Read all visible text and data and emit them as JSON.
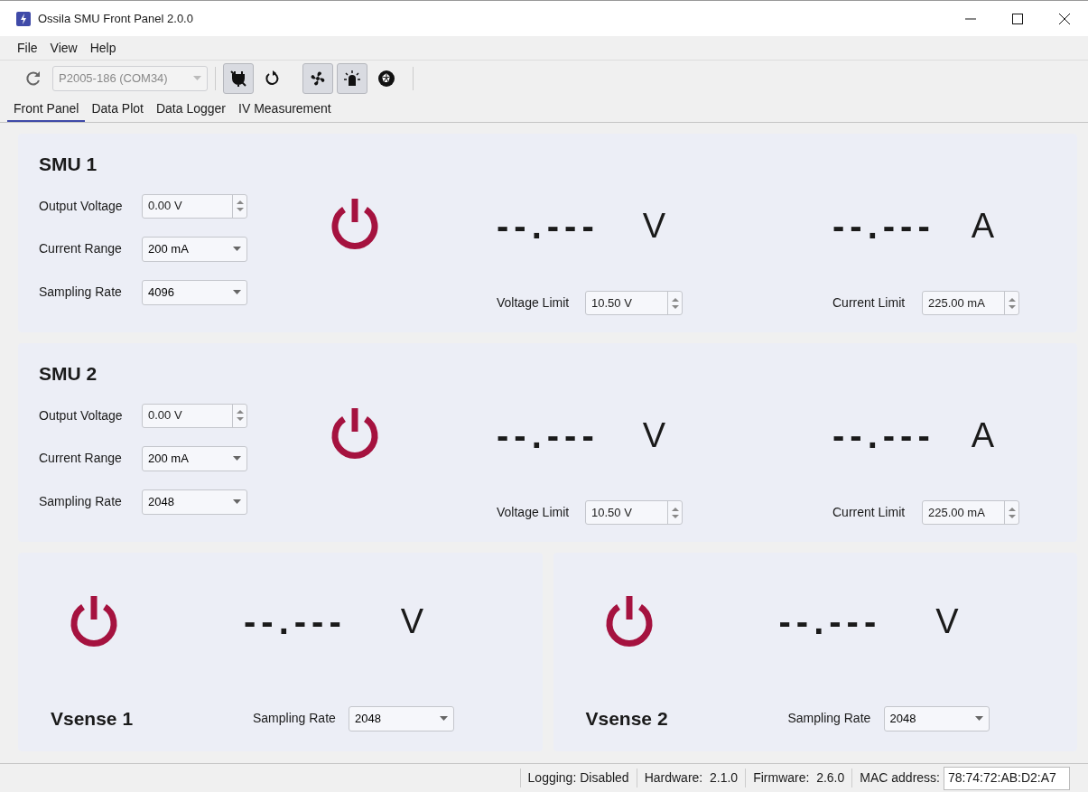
{
  "window": {
    "title": "Ossila SMU Front Panel 2.0.0"
  },
  "menu": [
    "File",
    "View",
    "Help"
  ],
  "toolbar": {
    "device": {
      "value": "P2005-186 (COM34)",
      "disabled": true
    },
    "buttons": [
      {
        "kind": "unplug",
        "pressed": true
      },
      {
        "kind": "reset",
        "pressed": false
      },
      {
        "kind": "fan",
        "pressed": true
      },
      {
        "kind": "light",
        "pressed": true
      },
      {
        "kind": "shutter",
        "pressed": false
      }
    ]
  },
  "tabs": [
    {
      "label": "Front Panel",
      "selected": true
    },
    {
      "label": "Data Plot",
      "selected": false
    },
    {
      "label": "Data Logger",
      "selected": false
    },
    {
      "label": "IV Measurement",
      "selected": false
    }
  ],
  "smus": [
    {
      "title": "SMU 1",
      "output_voltage": {
        "label": "Output Voltage",
        "value": "0.00 V"
      },
      "current_range": {
        "label": "Current Range",
        "value": "200 mA"
      },
      "sampling_rate": {
        "label": "Sampling Rate",
        "value": "4096"
      },
      "voltage_reading": "--.---",
      "voltage_unit": "V",
      "current_reading": "--.---",
      "current_unit": "A",
      "voltage_limit": {
        "label": "Voltage Limit",
        "value": "10.50 V"
      },
      "current_limit": {
        "label": "Current Limit",
        "value": "225.00 mA"
      }
    },
    {
      "title": "SMU 2",
      "output_voltage": {
        "label": "Output Voltage",
        "value": "0.00 V"
      },
      "current_range": {
        "label": "Current Range",
        "value": "200 mA"
      },
      "sampling_rate": {
        "label": "Sampling Rate",
        "value": "2048"
      },
      "voltage_reading": "--.---",
      "voltage_unit": "V",
      "current_reading": "--.---",
      "current_unit": "A",
      "voltage_limit": {
        "label": "Voltage Limit",
        "value": "10.50 V"
      },
      "current_limit": {
        "label": "Current Limit",
        "value": "225.00 mA"
      }
    }
  ],
  "vsense": [
    {
      "title": "Vsense 1",
      "reading": "--.---",
      "unit": "V",
      "sampling_rate": {
        "label": "Sampling Rate",
        "value": "2048"
      }
    },
    {
      "title": "Vsense 2",
      "reading": "--.---",
      "unit": "V",
      "sampling_rate": {
        "label": "Sampling Rate",
        "value": "2048"
      }
    }
  ],
  "status_bar": {
    "logging": "Logging: Disabled",
    "hardware": "Hardware:  2.1.0",
    "firmware": "Firmware:  2.6.0",
    "mac_label": "MAC address:",
    "mac_value": "78:74:72:AB:D2:A7"
  }
}
